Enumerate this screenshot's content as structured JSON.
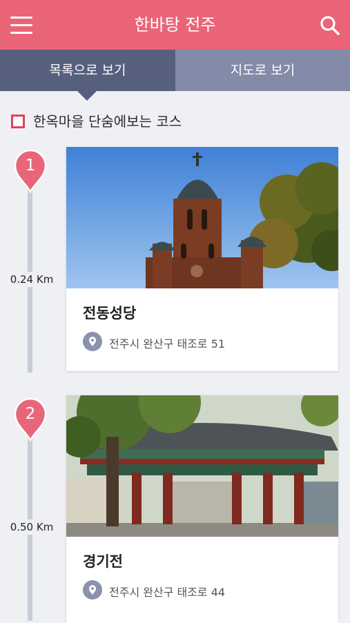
{
  "appbar": {
    "title": "한바탕 전주",
    "menu_icon": "menu-icon",
    "search_icon": "search-icon"
  },
  "tabs": [
    {
      "label": "목록으로 보기",
      "active": true
    },
    {
      "label": "지도로 보기",
      "active": false
    }
  ],
  "section": {
    "title": "한옥마을 단숨에보는 코스"
  },
  "stops": [
    {
      "number": "1",
      "distance": "0.24 Km",
      "name": "전동성당",
      "address": "전주시 완산구 태조로 51"
    },
    {
      "number": "2",
      "distance": "0.50 Km",
      "name": "경기전",
      "address": "전주시 완산구 태조로 44"
    }
  ],
  "colors": {
    "accent": "#ea6477",
    "tab_active": "#56607e",
    "tab_inactive": "#838ba8",
    "pin": "#e8667a"
  }
}
